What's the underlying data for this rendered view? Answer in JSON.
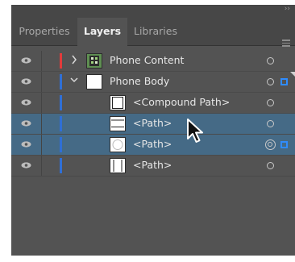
{
  "panel": {
    "collapse_glyph": "››",
    "tabs": [
      {
        "label": "Properties",
        "active": false
      },
      {
        "label": "Layers",
        "active": true
      },
      {
        "label": "Libraries",
        "active": false
      }
    ],
    "menu_icon": "hamburger-icon"
  },
  "layers": [
    {
      "name": "Phone Content",
      "level": 0,
      "expanded": false,
      "color": "#e23b3b",
      "thumb": "image",
      "target": "circle",
      "selected": false,
      "selected_square": false,
      "corner": false
    },
    {
      "name": "Phone Body",
      "level": 0,
      "expanded": true,
      "color": "#2f6fd6",
      "thumb": "blank",
      "target": "circle",
      "selected": false,
      "selected_square": true,
      "corner": true
    },
    {
      "name": "<Compound Path>",
      "level": 1,
      "color": "#2f6fd6",
      "thumb": "rect-outline",
      "target": "circle",
      "selected": false,
      "selected_square": false,
      "corner": false
    },
    {
      "name": "<Path>",
      "level": 1,
      "color": "#2f6fd6",
      "thumb": "bars",
      "target": "circle",
      "selected": true,
      "selected_square": false,
      "corner": false
    },
    {
      "name": "<Path>",
      "level": 1,
      "color": "#2f6fd6",
      "thumb": "circle",
      "target": "double-ring",
      "selected": true,
      "selected_square": true,
      "corner": false
    },
    {
      "name": "<Path>",
      "level": 1,
      "color": "#2f6fd6",
      "thumb": "frame",
      "target": "circle",
      "selected": false,
      "selected_square": false,
      "corner": false
    }
  ],
  "colors": {
    "panel_bg": "#535353",
    "selected_row": "#456a86",
    "selection_blue": "#2f8cff"
  }
}
